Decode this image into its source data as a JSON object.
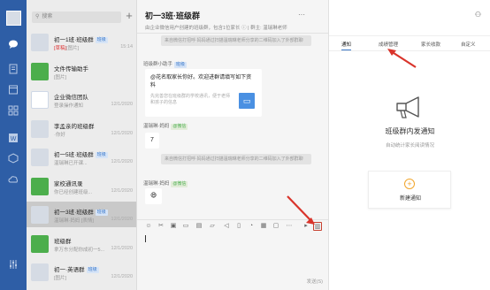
{
  "search": {
    "placeholder": "搜索",
    "icon": "search-icon"
  },
  "add_button": "+",
  "conversations": [
    {
      "name": "初一1班·班级群",
      "tag": "班级",
      "preview_highlight": "[草稿]",
      "preview": "[图片]",
      "time": "15:14",
      "avatar_color": "#d5dbe4",
      "selected": false
    },
    {
      "name": "文件传输助手",
      "tag": "",
      "preview_highlight": "",
      "preview": "[图片]",
      "time": "",
      "avatar_color": "#4cae4c",
      "selected": false
    },
    {
      "name": "企业微信团队",
      "tag": "",
      "preview_highlight": "",
      "preview": "登录操作通知",
      "time": "12/1/2020",
      "avatar_color": "#ffffff",
      "selected": false
    },
    {
      "name": "李孟亲的班级群",
      "tag": "",
      "preview_highlight": "",
      "preview": "·你好",
      "time": "12/1/2020",
      "avatar_color": "#d5dbe4",
      "selected": false
    },
    {
      "name": "初一5班·班级群",
      "tag": "班级",
      "preview_highlight": "",
      "preview": "温瑞琳已开课...",
      "time": "12/1/2020",
      "avatar_color": "#d5dbe4",
      "selected": false
    },
    {
      "name": "家校通讯录",
      "tag": "",
      "preview_highlight": "",
      "preview": "你已经创建班级...",
      "time": "12/1/2020",
      "avatar_color": "#4cae4c",
      "selected": false
    },
    {
      "name": "初一3班·班级群",
      "tag": "班级",
      "preview_highlight": "",
      "preview": "温瑞琳·妈妈 [表情]",
      "time": "12/1/2020",
      "avatar_color": "#d5dbe4",
      "selected": true
    },
    {
      "name": "班级群",
      "tag": "",
      "preview_highlight": "",
      "preview": "拿万东分配你成初一5...",
      "time": "12/1/2020",
      "avatar_color": "#4cae4c",
      "selected": false
    },
    {
      "name": "初一·英语群",
      "tag": "班级",
      "preview_highlight": "",
      "preview": "[图片]",
      "time": "12/1/2020",
      "avatar_color": "#d5dbe4",
      "selected": false
    }
  ],
  "chat": {
    "title": "初一3班·班级群",
    "subtitle": "由企业微信用户创建的班级群，包含1位家长 ⓘ | 群主: 温瑞琳老师",
    "sys_msg_1": "来自微信打招呼·妈妈通过扫描温瑞琳老师分享的二维码加入了外部群聊",
    "bot_name": "班级群小助手",
    "bot_tag": "班级",
    "card_title": "@花名取家长你好。欢迎进群请填写如下资料",
    "card_desc": "先完善您在班级群的学校通讯，便于老师和孩子的信息",
    "card_icon": "form-icon",
    "sender_1": "温瑞琳·妈妈",
    "sender_1_tag": "@微信",
    "msg_1": "7",
    "sys_msg_2": "来自微信打招呼·妈妈通过扫描温瑞琳老师分享的二维码加入了外部群聊",
    "sender_2": "温瑞琳·妈妈",
    "sender_2_tag": "@微信",
    "msg_2": "😄",
    "send_label": "发送(S)"
  },
  "right_panel": {
    "tabs": [
      "通知",
      "成绩管理",
      "家长收款",
      "自定义"
    ],
    "selected_tab": 0,
    "empty_title": "班级群内发通知",
    "empty_subtitle": "自动统计家长阅读情况",
    "new_button": "新建通知"
  },
  "colors": {
    "rail": "#2e5ea6",
    "accent": "#3a78c9",
    "highlight": "#c7402f",
    "orange": "#f1a52b"
  }
}
